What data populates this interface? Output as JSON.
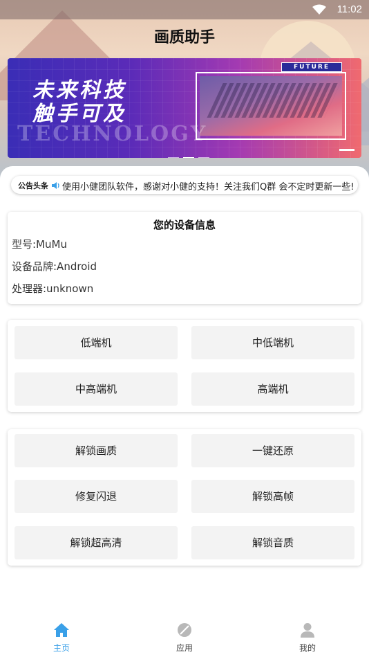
{
  "status_bar": {
    "time": "11:02"
  },
  "header": {
    "title": "画质助手"
  },
  "banner": {
    "headline_line1": "未来科技",
    "headline_line2": "触手可及",
    "watermark": "TECHNOLOGY",
    "tag": "FUTURE"
  },
  "notice": {
    "label": "公告头条",
    "text": "使用小健团队软件，感谢对小健的支持！关注我们Q群 会不定时更新一些!"
  },
  "device_info": {
    "title": "您的设备信息",
    "model": "型号:MuMu",
    "brand": "设备品牌:Android",
    "processor": "处理器:unknown"
  },
  "tiers": {
    "low": "低端机",
    "mid_low": "中低端机",
    "mid_high": "中高端机",
    "high": "高端机"
  },
  "actions": {
    "unlock_quality": "解锁画质",
    "one_click_restore": "一键还原",
    "fix_crash": "修复闪退",
    "unlock_high_fps": "解锁高帧",
    "unlock_ultra_hd": "解锁超高清",
    "unlock_audio": "解锁音质"
  },
  "bottom_nav": {
    "home": "主页",
    "apps": "应用",
    "mine": "我的",
    "active_color": "#3aa0e8"
  }
}
